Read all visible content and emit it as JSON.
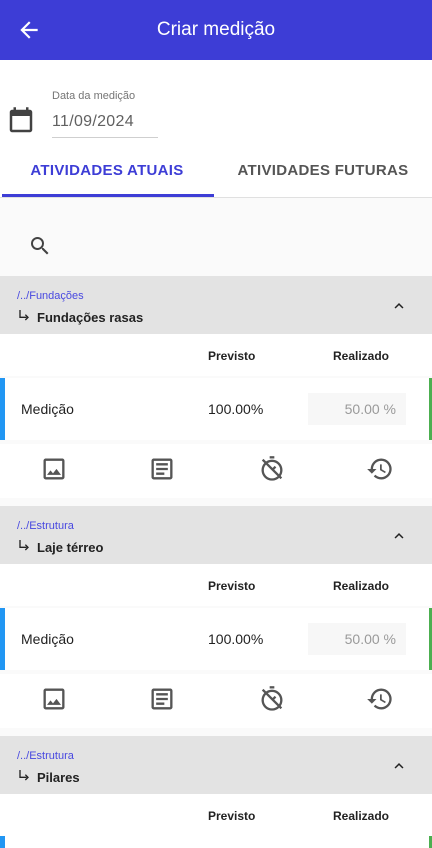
{
  "appbar": {
    "title": "Criar medição"
  },
  "date": {
    "label": "Data da medição",
    "value": "11/09/2024"
  },
  "tabs": [
    {
      "label": "ATIVIDADES ATUAIS"
    },
    {
      "label": "ATIVIDADES FUTURAS"
    }
  ],
  "sections": [
    {
      "path": "/../Fundações",
      "name": "Fundações rasas",
      "col_previsto": "Previsto",
      "col_realizado": "Realizado",
      "row_label": "Medição",
      "previsto": "100.00%",
      "realizado": "50.00 %"
    },
    {
      "path": "/../Estrutura",
      "name": "Laje térreo",
      "col_previsto": "Previsto",
      "col_realizado": "Realizado",
      "row_label": "Medição",
      "previsto": "100.00%",
      "realizado": "50.00 %"
    },
    {
      "path": "/../Estrutura",
      "name": "Pilares",
      "col_previsto": "Previsto",
      "col_realizado": "Realizado"
    }
  ],
  "icons": {
    "back": "arrow-back-icon",
    "calendar": "calendar-icon",
    "search": "search-icon",
    "collapse": "chevron-up-icon",
    "photo": "image-icon",
    "notes": "notes-icon",
    "timer": "timer-off-icon",
    "history": "history-icon"
  },
  "colors": {
    "primary": "#3d3dd6",
    "row_left_accent": "#2196f3",
    "row_right_accent": "#4caf50"
  }
}
